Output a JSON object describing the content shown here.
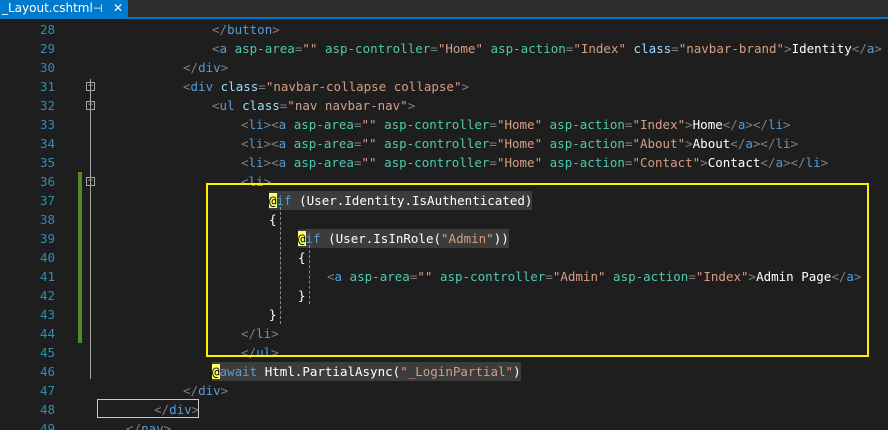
{
  "tab": {
    "title": "_Layout.cshtml",
    "pin_icon": "⊣",
    "close_icon": "✕"
  },
  "colors": {
    "accent": "#007acc",
    "line_number": "#2b91af",
    "highlight_box": "#fff200",
    "change_bar": "#4e8c2d"
  },
  "lines": [
    {
      "n": "28",
      "tokens": [
        [
          "tag",
          "</"
        ],
        [
          "name",
          "button"
        ],
        [
          "tag",
          ">"
        ]
      ]
    },
    {
      "n": "29",
      "tokens": [
        [
          "tag",
          "<"
        ],
        [
          "name",
          "a"
        ],
        [
          "txt",
          " "
        ],
        [
          "helper",
          "asp-area"
        ],
        [
          "tag",
          "="
        ],
        [
          "str",
          "\"\""
        ],
        [
          "txt",
          " "
        ],
        [
          "helper",
          "asp-controller"
        ],
        [
          "tag",
          "="
        ],
        [
          "str",
          "\"Home\""
        ],
        [
          "txt",
          " "
        ],
        [
          "helper",
          "asp-action"
        ],
        [
          "tag",
          "="
        ],
        [
          "str",
          "\"Index\""
        ],
        [
          "txt",
          " "
        ],
        [
          "attr",
          "class"
        ],
        [
          "tag",
          "="
        ],
        [
          "str",
          "\"navbar-brand\""
        ],
        [
          "tag",
          ">"
        ],
        [
          "txt",
          "Identity"
        ],
        [
          "tag",
          "</"
        ],
        [
          "name",
          "a"
        ],
        [
          "tag",
          ">"
        ]
      ]
    },
    {
      "n": "30",
      "tokens": [
        [
          "tag",
          "</"
        ],
        [
          "name",
          "div"
        ],
        [
          "tag",
          ">"
        ]
      ]
    },
    {
      "n": "31",
      "tokens": [
        [
          "tag",
          "<"
        ],
        [
          "name",
          "div"
        ],
        [
          "txt",
          " "
        ],
        [
          "attr",
          "class"
        ],
        [
          "tag",
          "="
        ],
        [
          "str",
          "\"navbar-collapse collapse\""
        ],
        [
          "tag",
          ">"
        ]
      ]
    },
    {
      "n": "32",
      "tokens": [
        [
          "tag",
          "<"
        ],
        [
          "name",
          "ul"
        ],
        [
          "txt",
          " "
        ],
        [
          "attr",
          "class"
        ],
        [
          "tag",
          "="
        ],
        [
          "str",
          "\"nav navbar-nav\""
        ],
        [
          "tag",
          ">"
        ]
      ]
    },
    {
      "n": "33",
      "tokens": [
        [
          "tag",
          "<"
        ],
        [
          "name",
          "li"
        ],
        [
          "tag",
          "><"
        ],
        [
          "name",
          "a"
        ],
        [
          "txt",
          " "
        ],
        [
          "helper",
          "asp-area"
        ],
        [
          "tag",
          "="
        ],
        [
          "str",
          "\"\""
        ],
        [
          "txt",
          " "
        ],
        [
          "helper",
          "asp-controller"
        ],
        [
          "tag",
          "="
        ],
        [
          "str",
          "\"Home\""
        ],
        [
          "txt",
          " "
        ],
        [
          "helper",
          "asp-action"
        ],
        [
          "tag",
          "="
        ],
        [
          "str",
          "\"Index\""
        ],
        [
          "tag",
          ">"
        ],
        [
          "txt",
          "Home"
        ],
        [
          "tag",
          "</"
        ],
        [
          "name",
          "a"
        ],
        [
          "tag",
          "></"
        ],
        [
          "name",
          "li"
        ],
        [
          "tag",
          ">"
        ]
      ]
    },
    {
      "n": "34",
      "tokens": [
        [
          "tag",
          "<"
        ],
        [
          "name",
          "li"
        ],
        [
          "tag",
          "><"
        ],
        [
          "name",
          "a"
        ],
        [
          "txt",
          " "
        ],
        [
          "helper",
          "asp-area"
        ],
        [
          "tag",
          "="
        ],
        [
          "str",
          "\"\""
        ],
        [
          "txt",
          " "
        ],
        [
          "helper",
          "asp-controller"
        ],
        [
          "tag",
          "="
        ],
        [
          "str",
          "\"Home\""
        ],
        [
          "txt",
          " "
        ],
        [
          "helper",
          "asp-action"
        ],
        [
          "tag",
          "="
        ],
        [
          "str",
          "\"About\""
        ],
        [
          "tag",
          ">"
        ],
        [
          "txt",
          "About"
        ],
        [
          "tag",
          "</"
        ],
        [
          "name",
          "a"
        ],
        [
          "tag",
          "></"
        ],
        [
          "name",
          "li"
        ],
        [
          "tag",
          ">"
        ]
      ]
    },
    {
      "n": "35",
      "tokens": [
        [
          "tag",
          "<"
        ],
        [
          "name",
          "li"
        ],
        [
          "tag",
          "><"
        ],
        [
          "name",
          "a"
        ],
        [
          "txt",
          " "
        ],
        [
          "helper",
          "asp-area"
        ],
        [
          "tag",
          "="
        ],
        [
          "str",
          "\"\""
        ],
        [
          "txt",
          " "
        ],
        [
          "helper",
          "asp-controller"
        ],
        [
          "tag",
          "="
        ],
        [
          "str",
          "\"Home\""
        ],
        [
          "txt",
          " "
        ],
        [
          "helper",
          "asp-action"
        ],
        [
          "tag",
          "="
        ],
        [
          "str",
          "\"Contact\""
        ],
        [
          "tag",
          ">"
        ],
        [
          "txt",
          "Contact"
        ],
        [
          "tag",
          "</"
        ],
        [
          "name",
          "a"
        ],
        [
          "tag",
          "></"
        ],
        [
          "name",
          "li"
        ],
        [
          "tag",
          ">"
        ]
      ]
    },
    {
      "n": "36",
      "tokens": [
        [
          "tag",
          "<"
        ],
        [
          "name",
          "li"
        ],
        [
          "tag",
          ">"
        ]
      ]
    },
    {
      "n": "37",
      "tokens": [
        [
          "razor",
          "@"
        ],
        [
          "kw",
          "if"
        ],
        [
          "txt",
          " (User.Identity.IsAuthenticated)"
        ]
      ]
    },
    {
      "n": "38",
      "tokens": [
        [
          "txt",
          "{"
        ]
      ]
    },
    {
      "n": "39",
      "tokens": [
        [
          "razor",
          "@"
        ],
        [
          "kw",
          "if"
        ],
        [
          "txt",
          " (User.IsInRole("
        ],
        [
          "str",
          "\"Admin\""
        ],
        [
          "txt",
          "))"
        ]
      ]
    },
    {
      "n": "40",
      "tokens": [
        [
          "txt",
          "{"
        ]
      ]
    },
    {
      "n": "41",
      "tokens": [
        [
          "tag",
          "<"
        ],
        [
          "name",
          "a"
        ],
        [
          "txt",
          " "
        ],
        [
          "helper",
          "asp-area"
        ],
        [
          "tag",
          "="
        ],
        [
          "str",
          "\"\""
        ],
        [
          "txt",
          " "
        ],
        [
          "helper",
          "asp-controller"
        ],
        [
          "tag",
          "="
        ],
        [
          "str",
          "\"Admin\""
        ],
        [
          "txt",
          " "
        ],
        [
          "helper",
          "asp-action"
        ],
        [
          "tag",
          "="
        ],
        [
          "str",
          "\"Index\""
        ],
        [
          "tag",
          ">"
        ],
        [
          "txt",
          "Admin Page"
        ],
        [
          "tag",
          "</"
        ],
        [
          "name",
          "a"
        ],
        [
          "tag",
          ">"
        ]
      ]
    },
    {
      "n": "42",
      "tokens": [
        [
          "txt",
          "}"
        ]
      ]
    },
    {
      "n": "43",
      "tokens": [
        [
          "txt",
          "}"
        ]
      ]
    },
    {
      "n": "44",
      "tokens": [
        [
          "tag",
          "</"
        ],
        [
          "name",
          "li"
        ],
        [
          "tag",
          ">"
        ]
      ]
    },
    {
      "n": "45",
      "tokens": [
        [
          "tag",
          "</"
        ],
        [
          "name",
          "ul"
        ],
        [
          "tag",
          ">"
        ]
      ]
    },
    {
      "n": "46",
      "tokens": [
        [
          "razor",
          "@"
        ],
        [
          "kw",
          "await"
        ],
        [
          "txt",
          " Html.PartialAsync("
        ],
        [
          "str",
          "\"_LoginPartial\""
        ],
        [
          "txt",
          ")"
        ]
      ]
    },
    {
      "n": "47",
      "tokens": [
        [
          "tag",
          "</"
        ],
        [
          "name",
          "div"
        ],
        [
          "tag",
          ">"
        ]
      ]
    },
    {
      "n": "48",
      "tokens": [
        [
          "tag",
          "</"
        ],
        [
          "name",
          "div"
        ],
        [
          "tag",
          ">"
        ]
      ]
    },
    {
      "n": "49",
      "tokens": [
        [
          "tag",
          "</"
        ],
        [
          "name",
          "nav"
        ],
        [
          "tag",
          ">"
        ]
      ]
    }
  ]
}
